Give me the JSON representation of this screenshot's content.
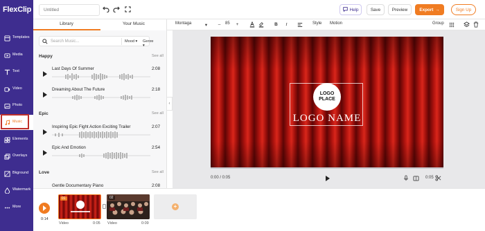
{
  "app": {
    "logo_text": "FlexClip"
  },
  "nav": {
    "items": [
      {
        "label": "Templates",
        "icon": "templates-icon"
      },
      {
        "label": "Media",
        "icon": "media-icon"
      },
      {
        "label": "Text",
        "icon": "text-icon"
      },
      {
        "label": "Video",
        "icon": "video-icon"
      },
      {
        "label": "Photo",
        "icon": "photo-icon"
      },
      {
        "label": "Music",
        "icon": "music-icon",
        "active": true
      },
      {
        "label": "Elements",
        "icon": "elements-icon"
      },
      {
        "label": "Overlays",
        "icon": "overlays-icon"
      },
      {
        "label": "Bkground",
        "icon": "background-icon"
      },
      {
        "label": "Watermark",
        "icon": "watermark-icon"
      },
      {
        "label": "More",
        "icon": "more-icon"
      }
    ]
  },
  "topbar": {
    "title_placeholder": "Untitled",
    "help_label": "Help",
    "save_label": "Save",
    "preview_label": "Preview",
    "export_label": "Export",
    "signup_label": "Sign Up"
  },
  "library": {
    "tabs": [
      "Library",
      "Your Music"
    ],
    "active_tab": "Library",
    "search_placeholder": "Search Music...",
    "filter_mood": "Mood",
    "filter_genre": "Genre",
    "see_all_label": "See all",
    "categories": [
      {
        "name": "Happy",
        "tracks": [
          {
            "title": "Last Days Of Summer",
            "duration": "2:08"
          },
          {
            "title": "Dreaming About The Future",
            "duration": "2:18"
          }
        ]
      },
      {
        "name": "Epic",
        "tracks": [
          {
            "title": "Inspiring Epic Fight Action Exciting Trailer",
            "duration": "2:07"
          },
          {
            "title": "Epic And Emotion",
            "duration": "2:54"
          }
        ]
      },
      {
        "name": "Love",
        "tracks": [
          {
            "title": "Gentle Documentary Piano",
            "duration": "2:08"
          }
        ]
      }
    ]
  },
  "format_toolbar": {
    "font": "Montaga",
    "font_size": "85",
    "style_label": "Style",
    "motion_label": "Motion",
    "group_label": "Group"
  },
  "canvas": {
    "logo_place_line1": "LOGO",
    "logo_place_line2": "PLACE",
    "logo_name": "LOGO NAME",
    "time_current": "0:00 / 0:05",
    "time_end": "0:05",
    "accent_color": "#f07c22",
    "background_color": "#8b0d0d"
  },
  "timeline": {
    "total_time": "0:14",
    "clips": [
      {
        "index": "01",
        "type": "Video",
        "duration": "0:05"
      },
      {
        "index": "02",
        "type": "Video",
        "duration": "0:09"
      }
    ]
  }
}
